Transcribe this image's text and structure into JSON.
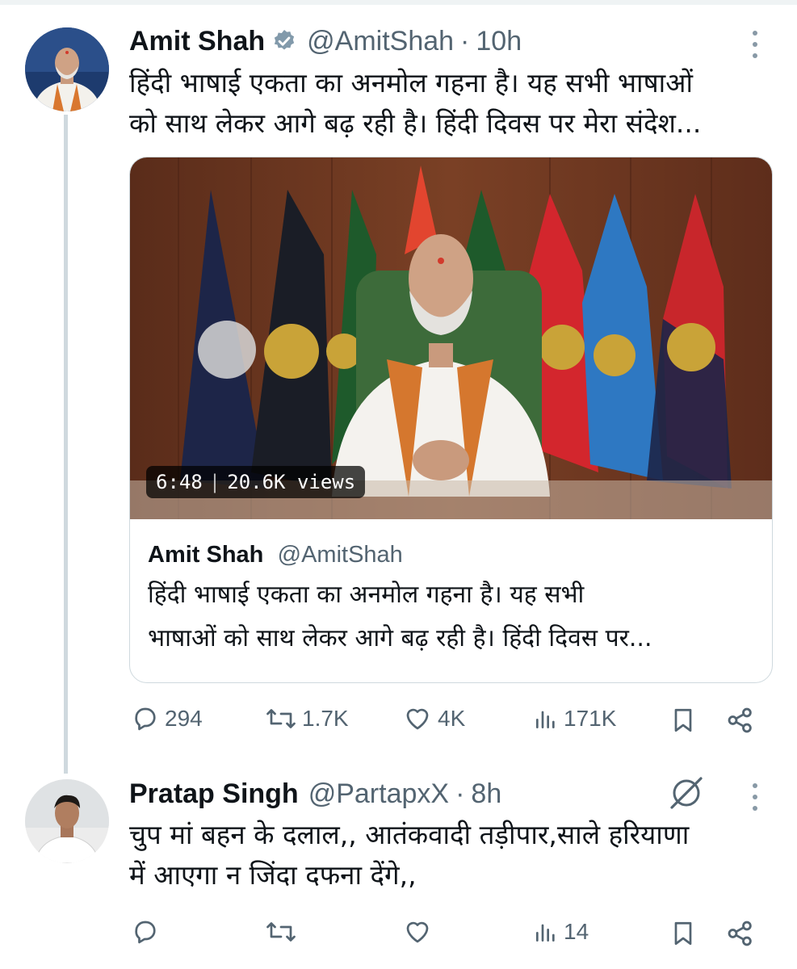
{
  "tweet": {
    "author_name": "Amit Shah",
    "author_handle": "@AmitShah",
    "time": "10h",
    "separator": "·",
    "text_lines": [
      "हिंदी भाषाई एकता का अनमोल गहना है। यह सभी भाषाओं",
      "को साथ लेकर आगे बढ़ रही है। हिंदी दिवस पर मेरा संदेश..."
    ],
    "card": {
      "video_duration": "6:48",
      "video_sep": "|",
      "video_views": "20.6K views",
      "author_name": "Amit Shah",
      "author_handle": "@AmitShah",
      "text_lines": [
        "हिंदी भाषाई एकता का अनमोल गहना है। यह सभी",
        "भाषाओं को साथ लेकर आगे बढ़ रही है। हिंदी दिवस पर..."
      ]
    },
    "stats": {
      "replies": "294",
      "retweets": "1.7K",
      "likes": "4K",
      "views": "171K"
    }
  },
  "reply": {
    "author_name": "Pratap Singh",
    "author_handle": "@PartapxX",
    "time": "8h",
    "separator": "·",
    "text_lines": [
      "चुप मां बहन के दलाल,, आतंकवादी तड़ीपार,साले हरियाणा",
      "में आएगा न जिंदा दफना देंगे,,"
    ],
    "stats": {
      "views": "14"
    }
  },
  "colors": {
    "text": "#0f1419",
    "secondary": "#536471",
    "verified_badge": "#829aab",
    "thread_line": "#cfd9de"
  }
}
